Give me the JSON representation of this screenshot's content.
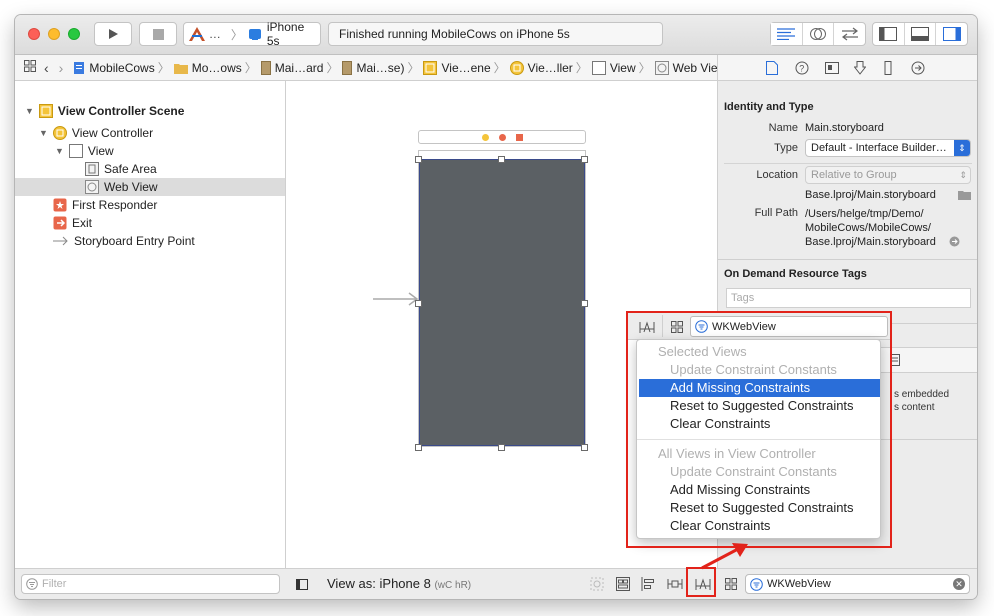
{
  "toolbar": {
    "scheme_app": "…",
    "scheme_device": "iPhone 5s",
    "status_text": "Finished running MobileCows on iPhone 5s"
  },
  "jumpbar": {
    "crumbs": [
      "MobileCows",
      "Mo…ows",
      "Mai…ard",
      "Mai…se)",
      "Vie…ene",
      "Vie…ller",
      "View",
      "Web View"
    ]
  },
  "outline": {
    "scene": "View Controller Scene",
    "view_controller": "View Controller",
    "view": "View",
    "safe_area": "Safe Area",
    "web_view": "Web View",
    "first_responder": "First Responder",
    "exit": "Exit",
    "entry_point": "Storyboard Entry Point"
  },
  "inspector": {
    "identity_title": "Identity and Type",
    "name_label": "Name",
    "name_value": "Main.storyboard",
    "type_label": "Type",
    "type_value": "Default - Interface Builder…",
    "location_label": "Location",
    "location_value": "Relative to Group",
    "location_file": "Base.lproj/Main.storyboard",
    "fullpath_label": "Full Path",
    "fullpath_value": [
      "/Users/helge/tmp/Demo/",
      "MobileCows/MobileCows/",
      "Base.lproj/Main.storyboard"
    ],
    "odr_title": "On Demand Resource Tags",
    "tags_placeholder": "Tags",
    "embedded_text": [
      "s embedded",
      "s content"
    ]
  },
  "popup": {
    "field_value": "WKWebView",
    "items": [
      {
        "label": "Selected Views",
        "kind": "header"
      },
      {
        "label": "Update Constraint Constants",
        "kind": "disabled"
      },
      {
        "label": "Add Missing Constraints",
        "kind": "selected"
      },
      {
        "label": "Reset to Suggested Constraints",
        "kind": "normal"
      },
      {
        "label": "Clear Constraints",
        "kind": "normal"
      },
      {
        "label": "All Views in View Controller",
        "kind": "header"
      },
      {
        "label": "Update Constraint Constants",
        "kind": "disabled"
      },
      {
        "label": "Add Missing Constraints",
        "kind": "normal"
      },
      {
        "label": "Reset to Suggested Constraints",
        "kind": "normal"
      },
      {
        "label": "Clear Constraints",
        "kind": "normal"
      }
    ]
  },
  "bottom": {
    "filter_placeholder": "Filter",
    "view_as": "View as: iPhone 8",
    "size_class": "(wC hR)",
    "wk_field": "WKWebView"
  },
  "colors": {
    "accent": "#2a6ed9",
    "highlight_border": "#e2231a",
    "web_view_fill": "#5b6064"
  }
}
